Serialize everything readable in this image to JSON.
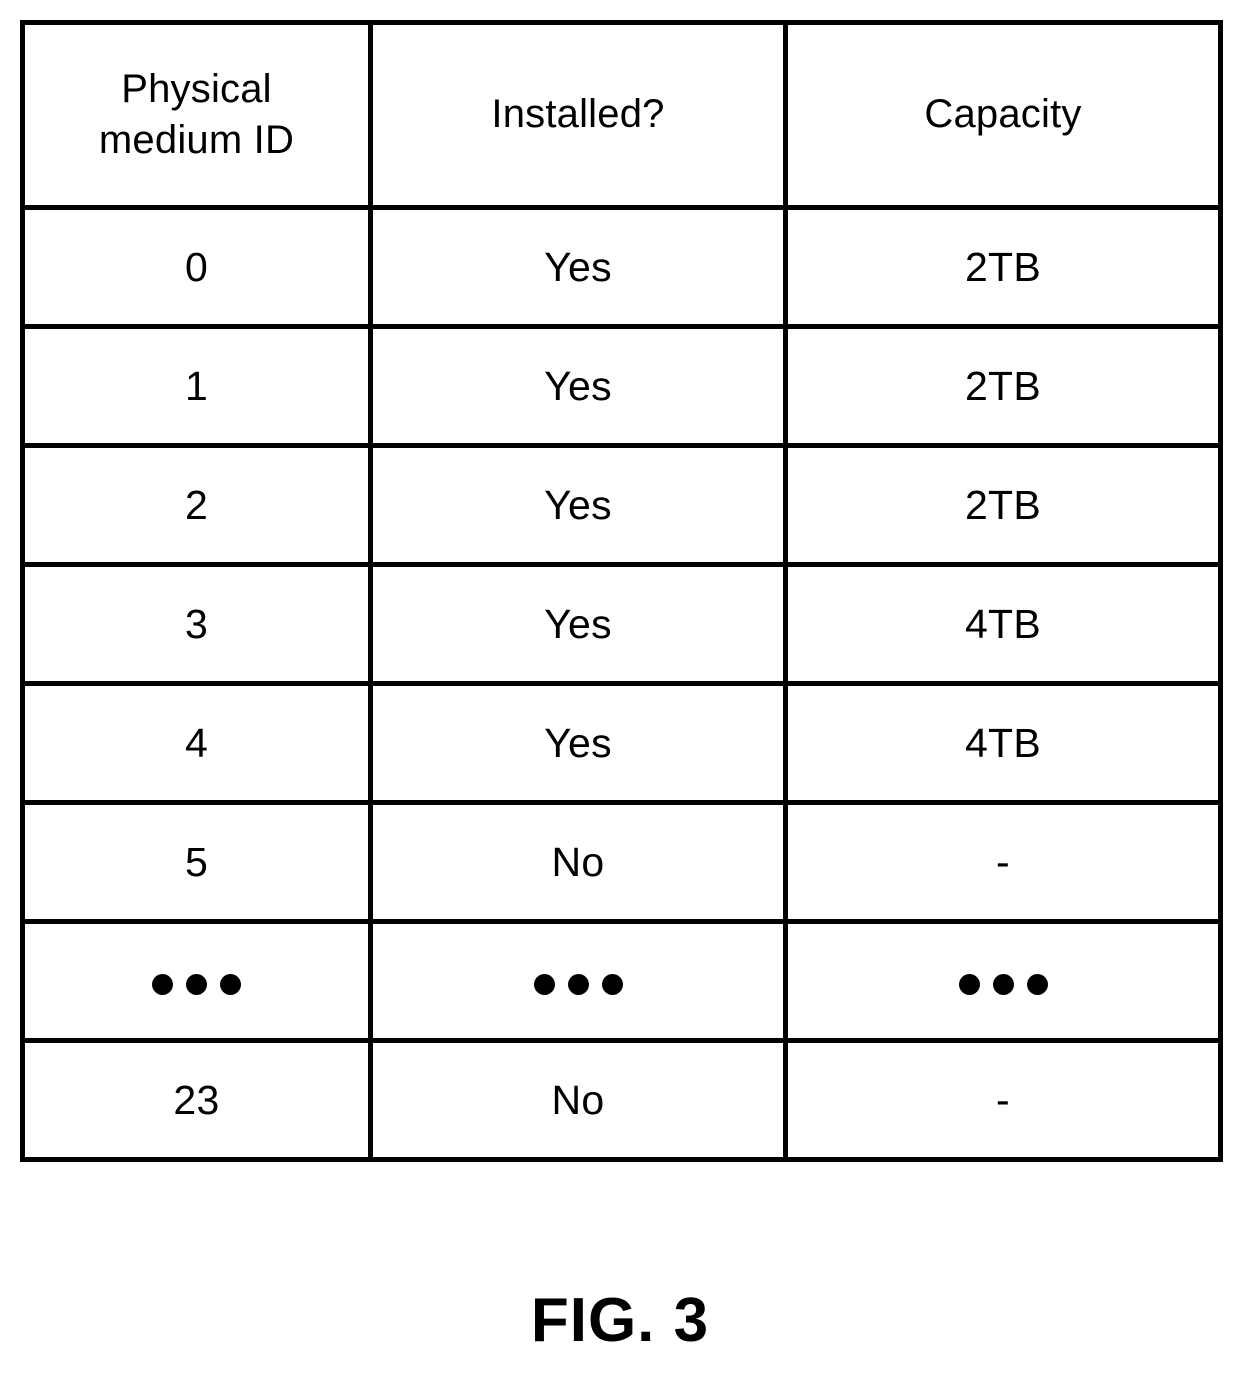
{
  "figure": {
    "caption": "FIG. 3"
  },
  "table": {
    "columns": [
      {
        "id": "physical_medium_id",
        "label_lines": [
          "Physical",
          "medium ID"
        ]
      },
      {
        "id": "installed",
        "label_lines": [
          "Installed?"
        ]
      },
      {
        "id": "capacity",
        "label_lines": [
          "Capacity"
        ]
      }
    ],
    "rows": [
      {
        "type": "data",
        "physical_medium_id": "0",
        "installed": "Yes",
        "capacity": "2TB"
      },
      {
        "type": "data",
        "physical_medium_id": "1",
        "installed": "Yes",
        "capacity": "2TB"
      },
      {
        "type": "data",
        "physical_medium_id": "2",
        "installed": "Yes",
        "capacity": "2TB"
      },
      {
        "type": "data",
        "physical_medium_id": "3",
        "installed": "Yes",
        "capacity": "4TB"
      },
      {
        "type": "data",
        "physical_medium_id": "4",
        "installed": "Yes",
        "capacity": "4TB"
      },
      {
        "type": "data",
        "physical_medium_id": "5",
        "installed": "No",
        "capacity": "-"
      },
      {
        "type": "ellipsis",
        "physical_medium_id": "•••",
        "installed": "•••",
        "capacity": "•••"
      },
      {
        "type": "data",
        "physical_medium_id": "23",
        "installed": "No",
        "capacity": "-"
      }
    ]
  },
  "style": {
    "ink_color": "#000000",
    "paper_color": "#ffffff"
  }
}
